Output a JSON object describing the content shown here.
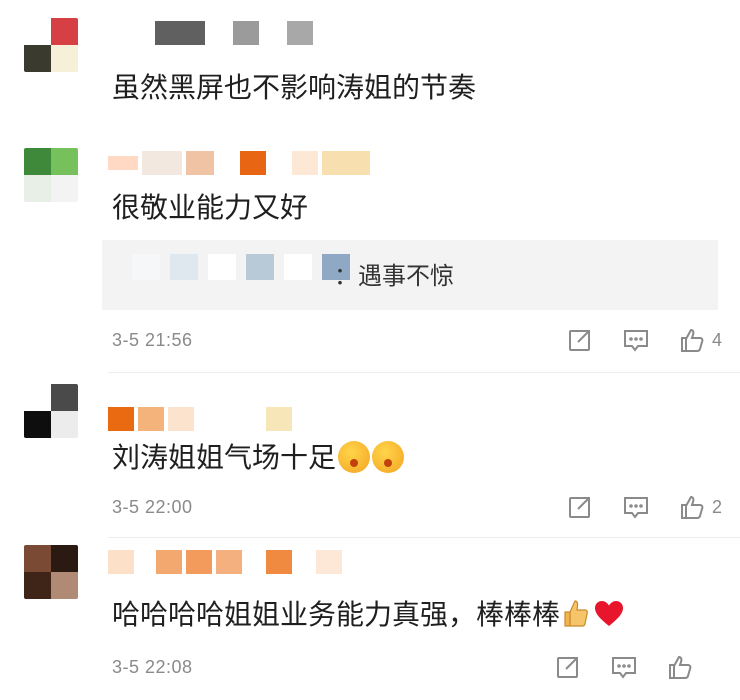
{
  "comments": [
    {
      "text": "虽然黑屏也不影响涛姐的节奏",
      "avatar_colors": [
        "#ffffff",
        "#d64045",
        "#3a3a2e",
        "#f6f0d8"
      ],
      "name_blur_colors": [
        "#ffffff",
        "#606060",
        "#ffffff",
        "#9b9b9b",
        "#ffffff",
        "#a8a8a8"
      ]
    },
    {
      "text": "很敬业能力又好",
      "avatar_colors": [
        "#3f8a3a",
        "#76c15b",
        "#e8efe6",
        "#f3f3f3"
      ],
      "name_blur_colors": [
        "#ffd9c4",
        "#f2e8e0",
        "#efc3a3",
        "#ffffff",
        "#e86514",
        "#ffffff",
        "#fde8d6",
        "#f7dfb0"
      ],
      "reply": {
        "text": "：遇事不惊",
        "blur_colors": [
          "#f5f7f9",
          "#dfe8ef",
          "#ffffff",
          "#b8c9d8",
          "#ffffff",
          "#8fa8c4"
        ]
      },
      "time": "3-5 21:56",
      "likes": "4"
    },
    {
      "text": "刘涛姐姐气场十足",
      "avatar_colors": [
        "#ffffff",
        "#4a4a4a",
        "#0e0e0e",
        "#ececec"
      ],
      "name_blur_colors": [
        "#e96a10",
        "#f3b37a",
        "#fbe3cd",
        "#ffffff",
        "#ffffff",
        "#f7e6b8"
      ],
      "time": "3-5 22:00",
      "likes": "2"
    },
    {
      "text": "哈哈哈哈姐姐业务能力真强，棒棒棒",
      "avatar_colors": [
        "#7a4a35",
        "#2b1a12",
        "#3f2418",
        "#b08a75"
      ],
      "name_blur_colors": [
        "#fde0c8",
        "#ffffff",
        "#f2a86f",
        "#f29b5c",
        "#f4b07f",
        "#ffffff",
        "#ef8a40",
        "#ffffff",
        "#fde7d6"
      ],
      "time": "3-5 22:08",
      "likes": ""
    }
  ],
  "icons": {
    "share": "share-icon",
    "comment": "comment-icon",
    "like": "thumbs-up-icon"
  }
}
